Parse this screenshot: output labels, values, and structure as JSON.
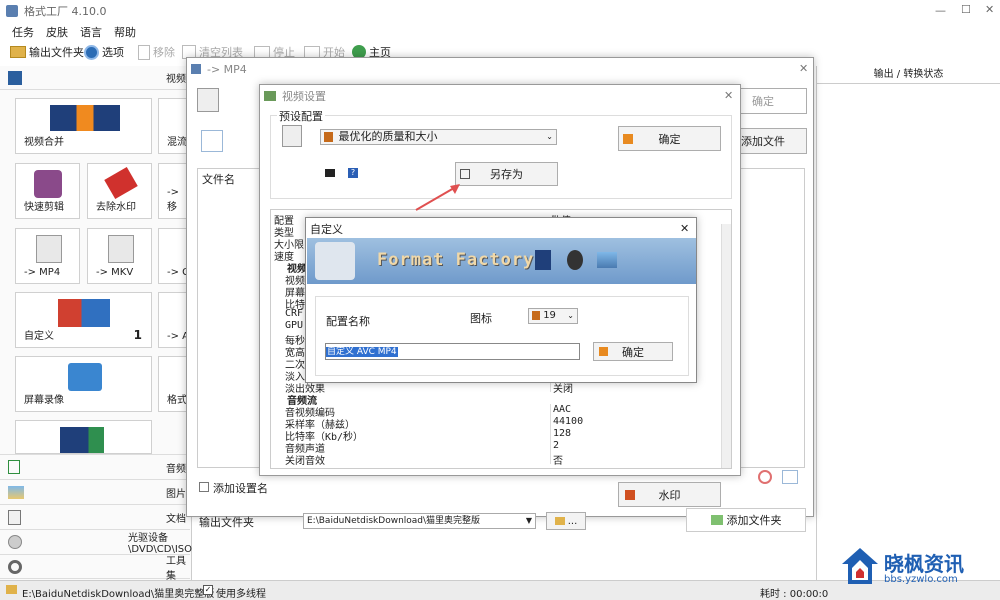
{
  "app": {
    "title": "格式工厂 4.10.0"
  },
  "menu": [
    "任务",
    "皮肤",
    "语言",
    "帮助"
  ],
  "toolbar": {
    "output_folder": "输出文件夹",
    "options": "选项",
    "remove": "移除",
    "clear_list": "清空列表",
    "stop": "停止",
    "start": "开始",
    "home": "主页"
  },
  "left": {
    "video_header": "视频",
    "tiles": [
      "视频合并",
      "快速剪辑",
      "去除水印",
      "-> MP4",
      "-> MKV",
      "自定义",
      "屏幕录像"
    ],
    "tiles_partial": [
      "混流",
      "-> 移",
      "-> G",
      "-> A",
      "格式"
    ],
    "custom_count": "1",
    "categories": [
      "音频",
      "图片",
      "文档",
      "光驱设备\\DVD\\CD\\ISO",
      "工具集"
    ]
  },
  "right_header": "输出 / 转换状态",
  "status": {
    "path": "E:\\BaiduNetdiskDownload\\猫里奥完整版",
    "multithread": "使用多线程",
    "elapsed": "耗时 : 00:00:0"
  },
  "mp4_window": {
    "title": "-> MP4",
    "ok": "确定",
    "add_file": "添加文件",
    "file_name_col": "文件名",
    "add_setting_name": "添加设置名",
    "output_folder_label": "输出文件夹",
    "output_path": "E:\\BaiduNetdiskDownload\\猫里奥完整版",
    "add_folder": "添加文件夹",
    "more": "..."
  },
  "video_settings": {
    "title": "视频设置",
    "preset_label": "预设配置",
    "preset_value": "最优化的质量和大小",
    "ok": "确定",
    "save_as": "另存为",
    "watermark": "水印",
    "col_config": "配置",
    "col_value": "数值",
    "rows_top": [
      "类型",
      "大小限",
      "速度"
    ],
    "video_stream": "视频",
    "video_rows": [
      "视频",
      "屏幕",
      "比特",
      "CRF",
      "GPU",
      "每秒",
      "宽高",
      "二次",
      "淡入"
    ],
    "fade_out": {
      "label": "淡出效果",
      "value": "关闭"
    },
    "audio_stream": "音频流",
    "audio_rows": [
      {
        "label": "音视频编码",
        "value": "AAC"
      },
      {
        "label": "采样率（赫兹）",
        "value": "44100"
      },
      {
        "label": "比特率（Kb/秒）",
        "value": "128"
      },
      {
        "label": "音频声道",
        "value": "2"
      },
      {
        "label": "关闭音效",
        "value": "否"
      }
    ]
  },
  "custom_dialog": {
    "title": "自定义",
    "banner": "Format Factory",
    "config_name_label": "配置名称",
    "icon_label": "图标",
    "icon_value": "19",
    "name_value": "自定义 AVC MP4",
    "ok": "确定"
  },
  "watermark_logo": {
    "name": "晓枫资讯",
    "url": "bbs.yzwlo.com"
  },
  "colors": {
    "accent": "#1e6fd9",
    "arrow": "#e05050",
    "banner": "#7fa8cf",
    "logo": "#1f5fb3"
  }
}
